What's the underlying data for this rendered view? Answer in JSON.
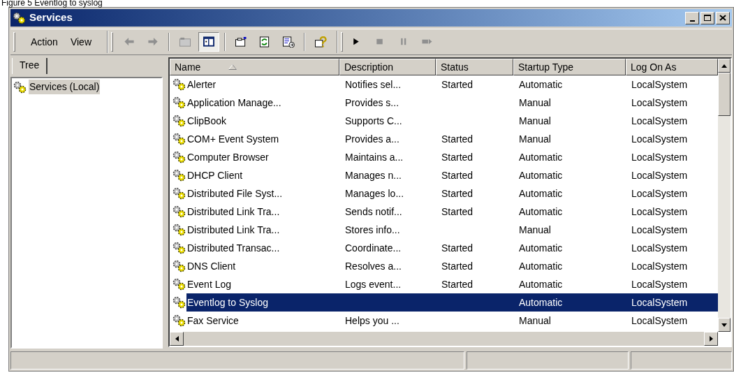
{
  "caption": "Figure 5 Eventlog to syslog",
  "window": {
    "title": "Services"
  },
  "menu": [
    {
      "label": "Action"
    },
    {
      "label": "View"
    }
  ],
  "toolbars": [
    {
      "groups": [
        [
          {
            "kind": "back",
            "disabled": true,
            "pressed": false
          },
          {
            "kind": "forward",
            "disabled": true,
            "pressed": false
          }
        ],
        [
          {
            "kind": "up",
            "disabled": true,
            "pressed": false
          },
          {
            "kind": "tree",
            "disabled": false,
            "pressed": true
          }
        ],
        [
          {
            "kind": "properties",
            "disabled": false,
            "pressed": false
          },
          {
            "kind": "refresh",
            "disabled": false,
            "pressed": false
          },
          {
            "kind": "export",
            "disabled": false,
            "pressed": false
          }
        ],
        [
          {
            "kind": "help",
            "disabled": false,
            "pressed": false
          }
        ]
      ]
    },
    {
      "groups": [
        [
          {
            "kind": "start",
            "disabled": false,
            "pressed": false
          },
          {
            "kind": "stop",
            "disabled": true,
            "pressed": false
          },
          {
            "kind": "pause",
            "disabled": true,
            "pressed": false
          },
          {
            "kind": "restart",
            "disabled": true,
            "pressed": false
          }
        ]
      ]
    }
  ],
  "tree_tab": {
    "label": "Tree"
  },
  "tree": {
    "items": [
      {
        "label": "Services (Local)",
        "selected": true
      }
    ]
  },
  "table": {
    "columns": [
      {
        "label": "Name",
        "sorted": true
      },
      {
        "label": "Description",
        "sorted": false
      },
      {
        "label": "Status",
        "sorted": false
      },
      {
        "label": "Startup Type",
        "sorted": false
      },
      {
        "label": "Log On As",
        "sorted": false
      }
    ],
    "rows": [
      {
        "cells": [
          "Alerter",
          "Notifies sel...",
          "Started",
          "Automatic",
          "LocalSystem"
        ],
        "selected": false
      },
      {
        "cells": [
          "Application Manage...",
          "Provides s...",
          "",
          "Manual",
          "LocalSystem"
        ],
        "selected": false
      },
      {
        "cells": [
          "ClipBook",
          "Supports C...",
          "",
          "Manual",
          "LocalSystem"
        ],
        "selected": false
      },
      {
        "cells": [
          "COM+ Event System",
          "Provides a...",
          "Started",
          "Manual",
          "LocalSystem"
        ],
        "selected": false
      },
      {
        "cells": [
          "Computer Browser",
          "Maintains a...",
          "Started",
          "Automatic",
          "LocalSystem"
        ],
        "selected": false
      },
      {
        "cells": [
          "DHCP Client",
          "Manages n...",
          "Started",
          "Automatic",
          "LocalSystem"
        ],
        "selected": false
      },
      {
        "cells": [
          "Distributed File Syst...",
          "Manages lo...",
          "Started",
          "Automatic",
          "LocalSystem"
        ],
        "selected": false
      },
      {
        "cells": [
          "Distributed Link Tra...",
          "Sends notif...",
          "Started",
          "Automatic",
          "LocalSystem"
        ],
        "selected": false
      },
      {
        "cells": [
          "Distributed Link Tra...",
          "Stores info...",
          "",
          "Manual",
          "LocalSystem"
        ],
        "selected": false
      },
      {
        "cells": [
          "Distributed Transac...",
          "Coordinate...",
          "Started",
          "Automatic",
          "LocalSystem"
        ],
        "selected": false
      },
      {
        "cells": [
          "DNS Client",
          "Resolves a...",
          "Started",
          "Automatic",
          "LocalSystem"
        ],
        "selected": false
      },
      {
        "cells": [
          "Event Log",
          "Logs event...",
          "Started",
          "Automatic",
          "LocalSystem"
        ],
        "selected": false
      },
      {
        "cells": [
          "Eventlog to Syslog",
          "",
          "",
          "Automatic",
          "LocalSystem"
        ],
        "selected": true
      },
      {
        "cells": [
          "Fax Service",
          "Helps you ...",
          "",
          "Manual",
          "LocalSystem"
        ],
        "selected": false
      }
    ]
  }
}
